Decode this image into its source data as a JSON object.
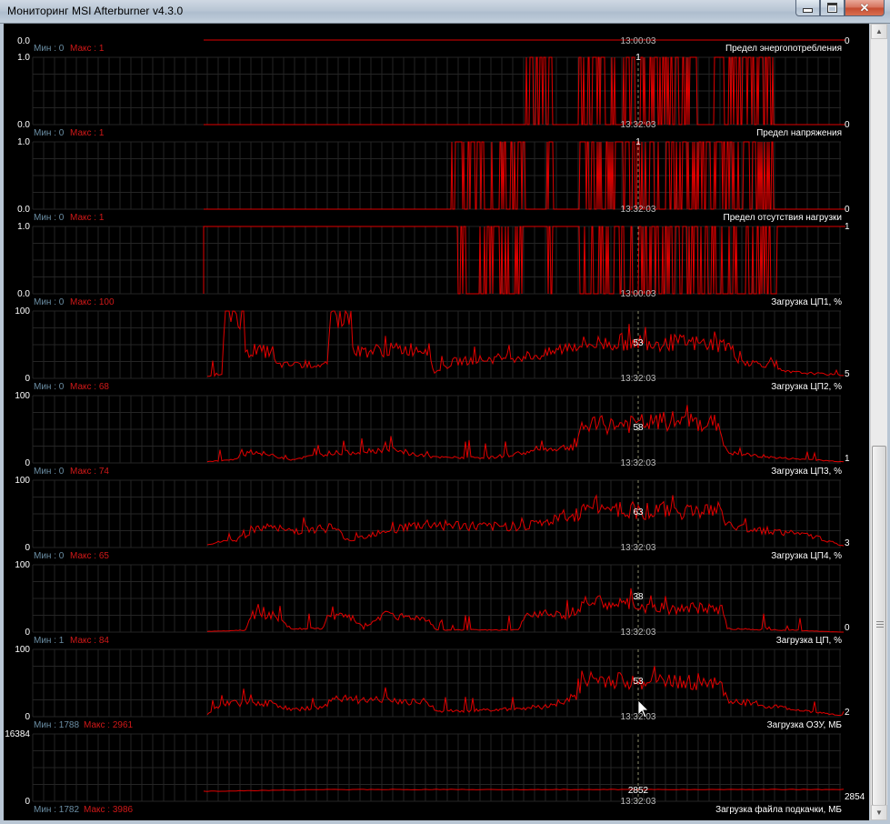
{
  "window": {
    "title": "Мониторинг MSI Afterburner v4.3.0",
    "buttons": [
      "minimize",
      "maximize",
      "close"
    ]
  },
  "colors": {
    "background": "#000000",
    "series": "#e00000",
    "min_label": "#6b8ea4",
    "max_label": "#d01818",
    "text": "#ffffff",
    "grid": "#242424",
    "cursor": "#8a8a6a"
  },
  "top_strip": {
    "ymax_label": "0.0",
    "time": "13:00:03",
    "right_value": "0"
  },
  "charts": [
    {
      "id": "power",
      "name": "Предел энергопотребления",
      "min": "Мин : 0",
      "max": "Макс : 1",
      "ymax": "1.0",
      "ymin": "0.0",
      "cursor_value": "1",
      "time": "13:32:03",
      "current": "0",
      "kind": "binary",
      "burst": [
        [
          577,
          608
        ],
        [
          637,
          850
        ]
      ]
    },
    {
      "id": "voltage",
      "name": "Предел напряжения",
      "min": "Мин : 0",
      "max": "Макс : 1",
      "ymax": "1.0",
      "ymin": "0.0",
      "cursor_value": "1",
      "time": "13:32:03",
      "current": "0",
      "kind": "binary",
      "burst": [
        [
          497,
          577
        ],
        [
          600,
          608
        ],
        [
          637,
          850
        ]
      ]
    },
    {
      "id": "noload",
      "name": "Предел отсутствия нагрузки",
      "min": "Мин : 0",
      "max": "Макс : 1",
      "ymax": "1.0",
      "ymin": "0.0",
      "cursor_value": "",
      "time": "13:00:03",
      "current": "1",
      "kind": "binary",
      "burst": [
        [
          497,
          577
        ],
        [
          600,
          608
        ],
        [
          637,
          855
        ]
      ]
    },
    {
      "id": "cpu1",
      "name": "Загрузка ЦП1, %",
      "min": "Мин : 0",
      "max": "Макс : 100",
      "ymax": "100",
      "ymin": "0",
      "cursor_value": "53",
      "time": "13:32:03",
      "current": "5",
      "kind": "load",
      "profile": [
        [
          228,
          3
        ],
        [
          244,
          5
        ],
        [
          247,
          98
        ],
        [
          268,
          97
        ],
        [
          270,
          40
        ],
        [
          300,
          40
        ],
        [
          303,
          20
        ],
        [
          360,
          20
        ],
        [
          365,
          95
        ],
        [
          385,
          95
        ],
        [
          390,
          40
        ],
        [
          470,
          45
        ],
        [
          478,
          8
        ],
        [
          500,
          25
        ],
        [
          600,
          35
        ],
        [
          630,
          50
        ],
        [
          700,
          55
        ],
        [
          800,
          50
        ],
        [
          815,
          25
        ],
        [
          850,
          20
        ],
        [
          860,
          10
        ],
        [
          925,
          5
        ]
      ]
    },
    {
      "id": "cpu2",
      "name": "Загрузка ЦП2, %",
      "min": "Мин : 0",
      "max": "Макс : 68",
      "ymax": "100",
      "ymin": "0",
      "cursor_value": "58",
      "time": "13:32:03",
      "current": "1",
      "kind": "load",
      "profile": [
        [
          228,
          2
        ],
        [
          260,
          5
        ],
        [
          275,
          18
        ],
        [
          320,
          5
        ],
        [
          365,
          15
        ],
        [
          380,
          15
        ],
        [
          420,
          20
        ],
        [
          480,
          8
        ],
        [
          540,
          8
        ],
        [
          600,
          20
        ],
        [
          635,
          25
        ],
        [
          640,
          55
        ],
        [
          700,
          58
        ],
        [
          740,
          62
        ],
        [
          790,
          58
        ],
        [
          800,
          15
        ],
        [
          850,
          8
        ],
        [
          925,
          2
        ]
      ]
    },
    {
      "id": "cpu3",
      "name": "Загрузка ЦП3, %",
      "min": "Мин : 0",
      "max": "Макс : 74",
      "ymax": "100",
      "ymin": "0",
      "cursor_value": "63",
      "time": "13:32:03",
      "current": "3",
      "kind": "load",
      "profile": [
        [
          228,
          5
        ],
        [
          260,
          12
        ],
        [
          290,
          30
        ],
        [
          320,
          25
        ],
        [
          365,
          30
        ],
        [
          385,
          10
        ],
        [
          420,
          25
        ],
        [
          470,
          35
        ],
        [
          540,
          30
        ],
        [
          590,
          35
        ],
        [
          630,
          45
        ],
        [
          650,
          63
        ],
        [
          700,
          55
        ],
        [
          790,
          55
        ],
        [
          805,
          30
        ],
        [
          850,
          25
        ],
        [
          900,
          15
        ],
        [
          925,
          3
        ]
      ]
    },
    {
      "id": "cpu4",
      "name": "Загрузка ЦП4, %",
      "min": "Мин : 0",
      "max": "Макс : 65",
      "ymax": "100",
      "ymin": "0",
      "cursor_value": "38",
      "time": "13:32:03",
      "current": "0",
      "kind": "load",
      "profile": [
        [
          228,
          1
        ],
        [
          270,
          3
        ],
        [
          275,
          25
        ],
        [
          300,
          25
        ],
        [
          320,
          5
        ],
        [
          355,
          5
        ],
        [
          360,
          25
        ],
        [
          390,
          20
        ],
        [
          400,
          5
        ],
        [
          420,
          25
        ],
        [
          470,
          20
        ],
        [
          480,
          3
        ],
        [
          570,
          3
        ],
        [
          580,
          28
        ],
        [
          610,
          30
        ],
        [
          630,
          20
        ],
        [
          640,
          45
        ],
        [
          700,
          40
        ],
        [
          710,
          35
        ],
        [
          795,
          35
        ],
        [
          800,
          5
        ],
        [
          870,
          3
        ],
        [
          925,
          0
        ]
      ]
    },
    {
      "id": "cpu",
      "name": "Загрузка ЦП, %",
      "min": "Мин : 1",
      "max": "Макс : 84",
      "ymax": "100",
      "ymin": "0",
      "cursor_value": "53",
      "time": "13:32:03",
      "current": "2",
      "kind": "load",
      "profile": [
        [
          228,
          3
        ],
        [
          245,
          20
        ],
        [
          300,
          20
        ],
        [
          320,
          10
        ],
        [
          360,
          15
        ],
        [
          365,
          30
        ],
        [
          400,
          25
        ],
        [
          470,
          22
        ],
        [
          480,
          8
        ],
        [
          540,
          10
        ],
        [
          600,
          15
        ],
        [
          635,
          30
        ],
        [
          640,
          55
        ],
        [
          700,
          52
        ],
        [
          790,
          52
        ],
        [
          800,
          25
        ],
        [
          850,
          15
        ],
        [
          925,
          2
        ]
      ]
    },
    {
      "id": "ram",
      "name": "Загрузка ОЗУ, МБ",
      "min": "Мин : 1788",
      "max": "Макс : 2961",
      "ymax": "16384",
      "ymin": "0",
      "cursor_value": "2852",
      "time": "13:32:03",
      "current": "2854",
      "kind": "flat",
      "level": 2852,
      "scale": 16384
    },
    {
      "id": "pagefile",
      "name": "Загрузка файла подкачки, МБ",
      "min": "Мин : 1782",
      "max": "Макс : 3986",
      "ymax": "",
      "ymin": "",
      "cursor_value": "",
      "time": "",
      "current": "",
      "kind": "header"
    }
  ]
}
